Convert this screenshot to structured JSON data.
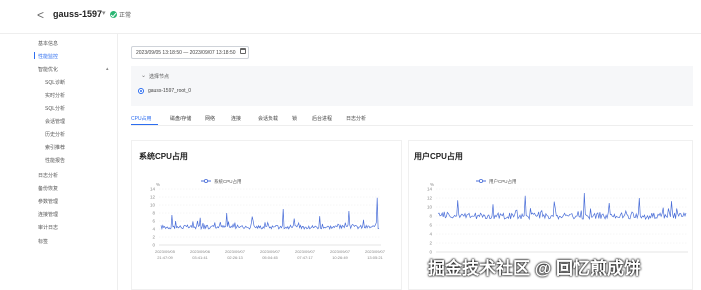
{
  "header": {
    "back": "<",
    "instance": "gauss-1597",
    "caret": "▾",
    "status": "正常"
  },
  "sidebar": {
    "items": [
      {
        "label": "基本信息"
      },
      {
        "label": "性能监控"
      },
      {
        "label": "智能优化"
      },
      {
        "label": "SQL诊断"
      },
      {
        "label": "实时分析"
      },
      {
        "label": "SQL分析"
      },
      {
        "label": "会话管理"
      },
      {
        "label": "历史分析"
      },
      {
        "label": "索引推荐"
      },
      {
        "label": "性能报告"
      },
      {
        "label": "日志分析"
      },
      {
        "label": "备份恢复"
      },
      {
        "label": "参数管理"
      },
      {
        "label": "连接管理"
      },
      {
        "label": "审计日志"
      },
      {
        "label": "标签"
      }
    ],
    "caret": "▴"
  },
  "filter": {
    "date_range": "2023/09/05 13:18:50 — 2023/09/07 13:18:50",
    "node_section_label": "选择节点",
    "node_caret": "⌄",
    "node_name": "gauss-1597_root_0"
  },
  "tabs": [
    {
      "label": "CPU占用"
    },
    {
      "label": "磁盘/存储"
    },
    {
      "label": "网络"
    },
    {
      "label": "连接"
    },
    {
      "label": "会话负载"
    },
    {
      "label": "锁"
    },
    {
      "label": "后台进程"
    },
    {
      "label": "日志分析"
    }
  ],
  "watermark": "掘金技术社区 @ 回忆煎成饼",
  "chart_data": [
    {
      "type": "line",
      "title": "系统CPU占用",
      "series": [
        {
          "name": "系统CPU占用",
          "color": "#4a6ed8"
        }
      ],
      "ylabel": "%",
      "ylim": [
        0,
        14
      ],
      "yticks": [
        0,
        2,
        4,
        6,
        8,
        10,
        12,
        14
      ],
      "x_tick_labels": [
        [
          "2023/09/05",
          "21:47:09"
        ],
        [
          "2023/09/06",
          "03:41:41"
        ],
        [
          "2023/09/07",
          "02:26:13"
        ],
        [
          "2023/09/07",
          "05:04:45"
        ],
        [
          "2023/09/07",
          "07:47:17"
        ],
        [
          "2023/09/07",
          "10:26:49"
        ],
        [
          "2023/09/07",
          "13:05:21"
        ]
      ],
      "baseline": 4.5,
      "noise": 0.5,
      "spikes": [
        [
          0.05,
          7.5
        ],
        [
          0.18,
          6.8
        ],
        [
          0.3,
          8.0
        ],
        [
          0.42,
          7.1
        ],
        [
          0.56,
          9.0
        ],
        [
          0.61,
          6.6
        ],
        [
          0.73,
          7.2
        ],
        [
          0.86,
          8.5
        ],
        [
          0.93,
          6.3
        ],
        [
          0.99,
          11.8
        ]
      ]
    },
    {
      "type": "line",
      "title": "用户CPU占用",
      "series": [
        {
          "name": "用户CPU占用",
          "color": "#4a6ed8"
        }
      ],
      "ylabel": "%",
      "ylim": [
        0,
        14
      ],
      "yticks": [
        0,
        2,
        4,
        6,
        8,
        10,
        12,
        14
      ],
      "x_tick_labels": [],
      "baseline": 8.0,
      "noise": 0.7,
      "spikes": [
        [
          0.08,
          11.5
        ],
        [
          0.22,
          10.6
        ],
        [
          0.35,
          12.5
        ],
        [
          0.47,
          11.2
        ],
        [
          0.59,
          13.1
        ],
        [
          0.69,
          10.9
        ],
        [
          0.81,
          12.0
        ],
        [
          0.94,
          11.3
        ]
      ],
      "dips": [
        [
          0.5,
          3.0
        ]
      ]
    }
  ]
}
